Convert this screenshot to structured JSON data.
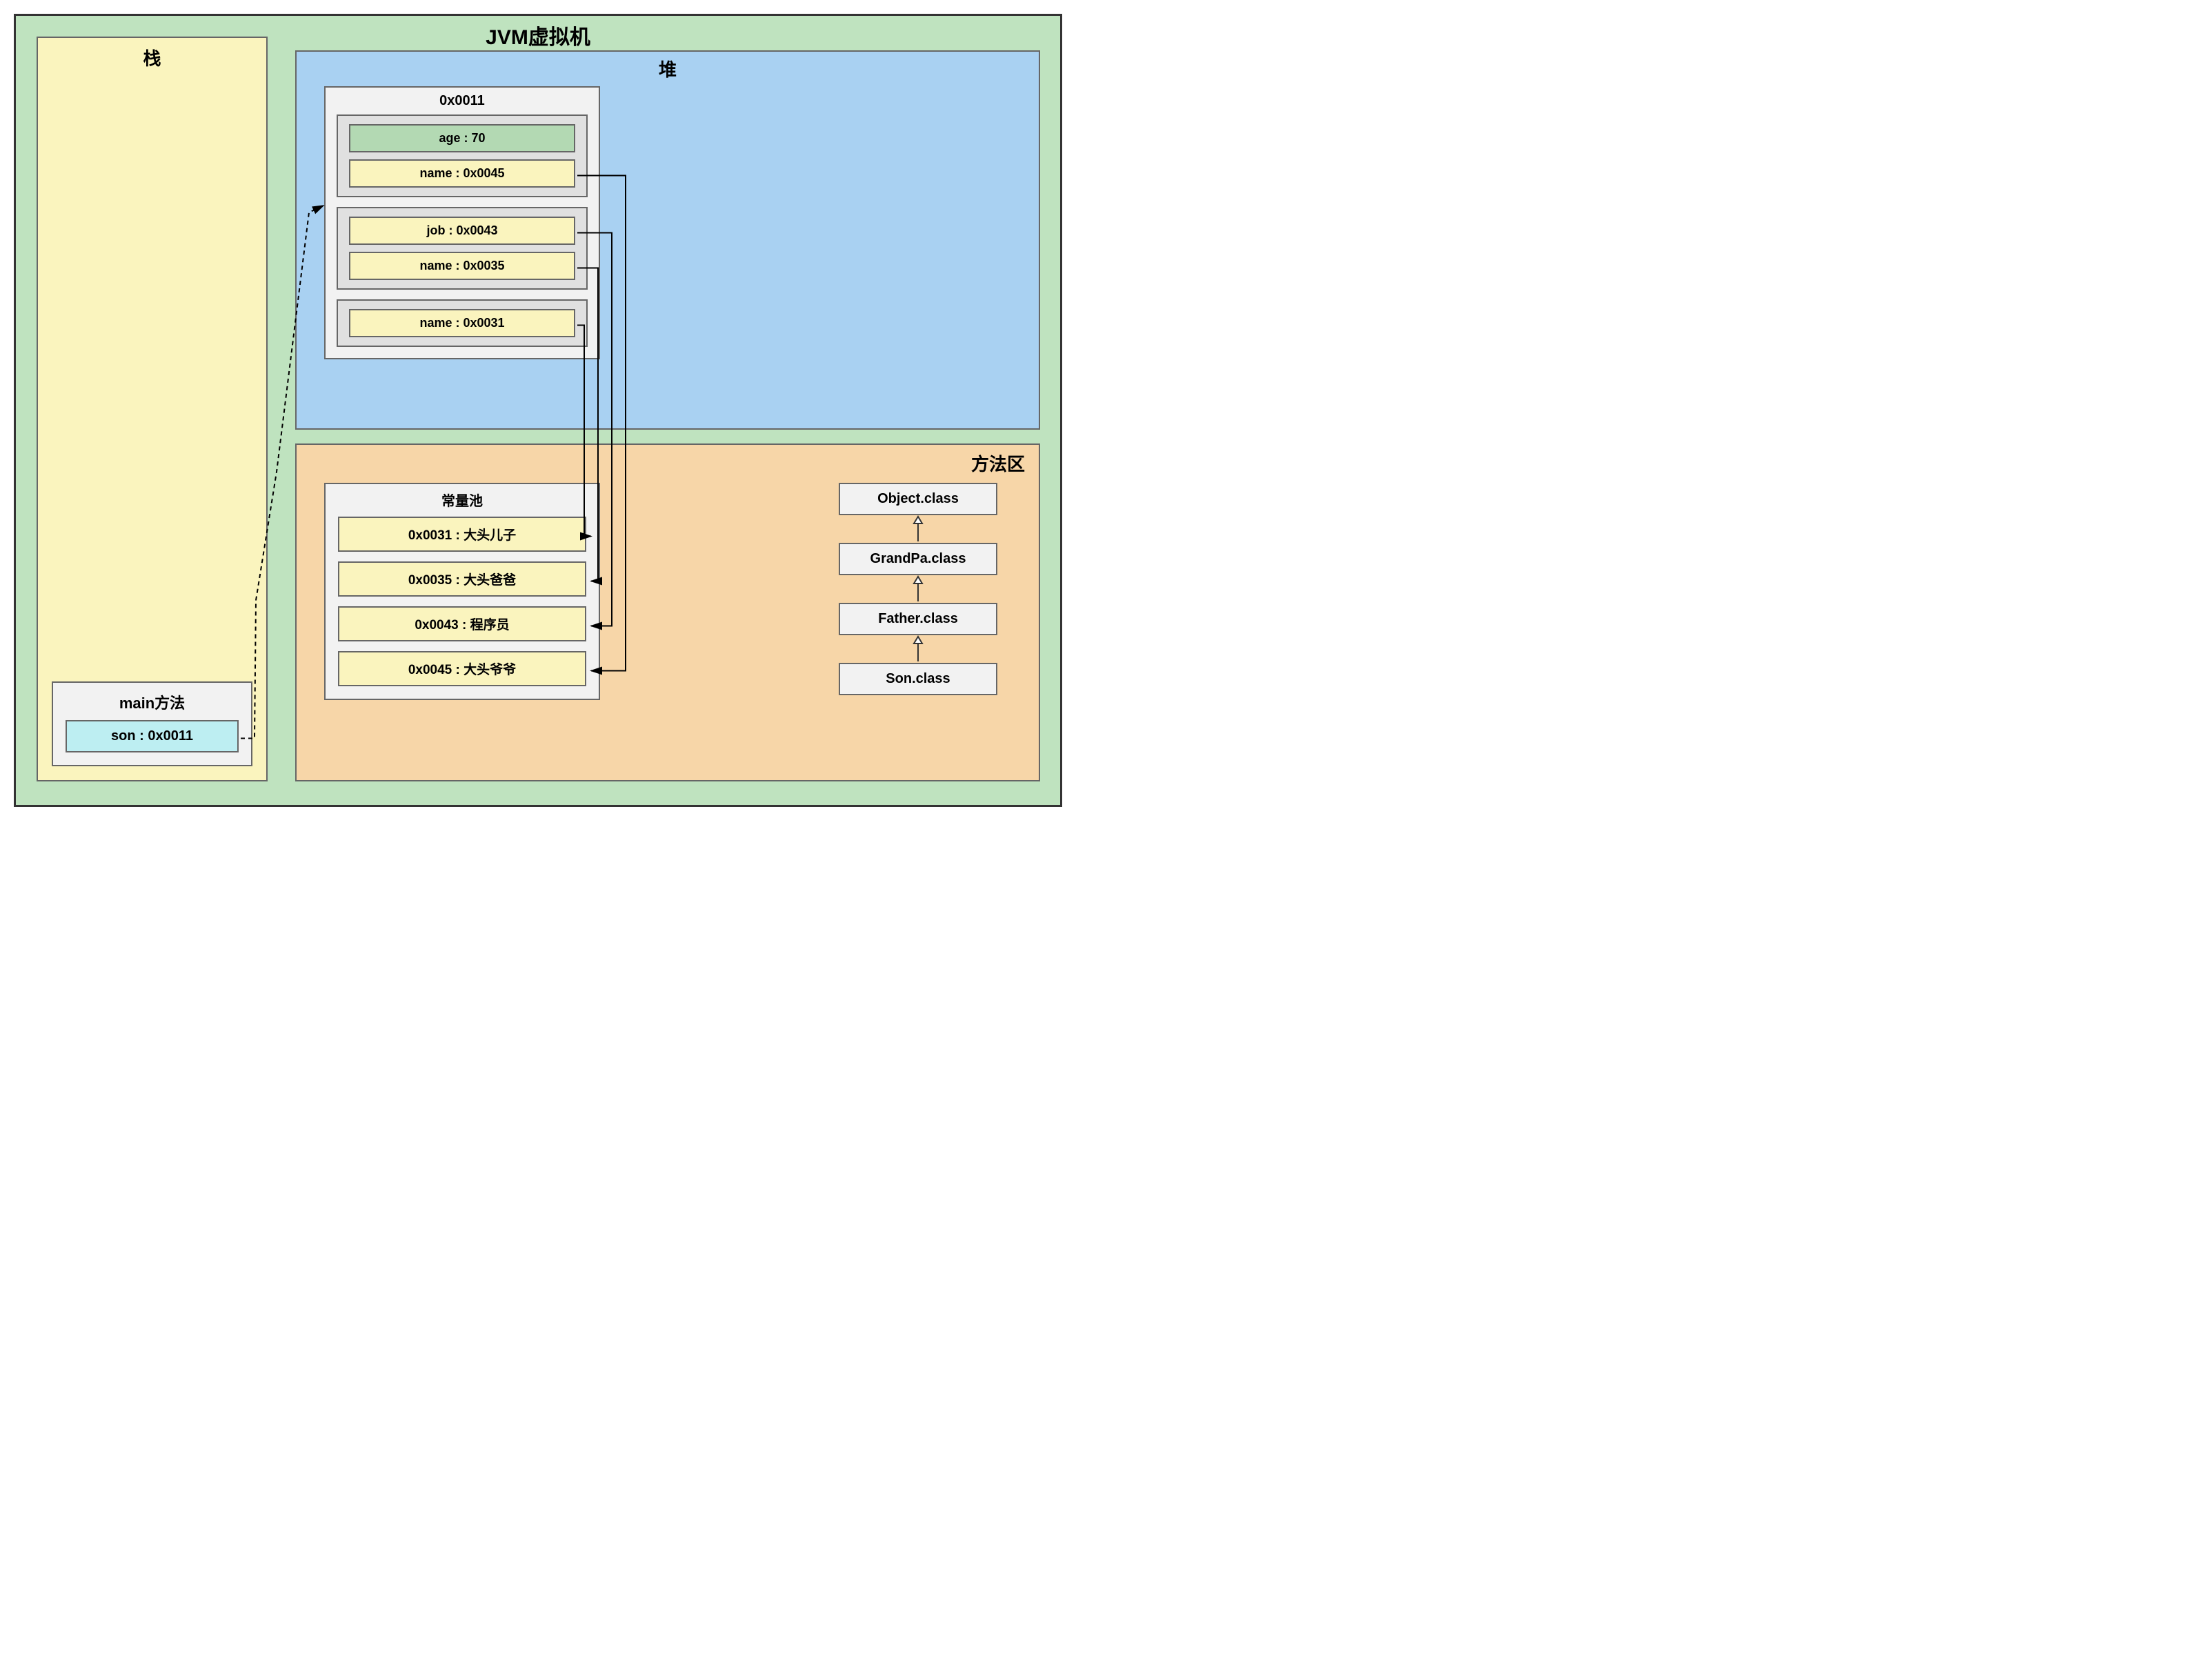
{
  "jvm": {
    "title": "JVM虚拟机"
  },
  "stack": {
    "title": "栈",
    "main": {
      "title": "main方法",
      "var": "son : 0x0011"
    }
  },
  "heap": {
    "title": "堆",
    "object": {
      "address": "0x0011",
      "groups": [
        {
          "fields": [
            {
              "text": "age : 70",
              "style": "green"
            },
            {
              "text": "name : 0x0045",
              "style": "yellow"
            }
          ]
        },
        {
          "fields": [
            {
              "text": "job : 0x0043",
              "style": "yellow"
            },
            {
              "text": "name : 0x0035",
              "style": "yellow"
            }
          ]
        },
        {
          "fields": [
            {
              "text": "name : 0x0031",
              "style": "yellow"
            }
          ]
        }
      ]
    }
  },
  "method": {
    "title": "方法区",
    "constPool": {
      "title": "常量池",
      "entries": [
        "0x0031 : 大头儿子",
        "0x0035 : 大头爸爸",
        "0x0043 : 程序员",
        "0x0045 : 大头爷爷"
      ]
    },
    "classes": [
      "Object.class",
      "GrandPa.class",
      "Father.class",
      "Son.class"
    ]
  }
}
